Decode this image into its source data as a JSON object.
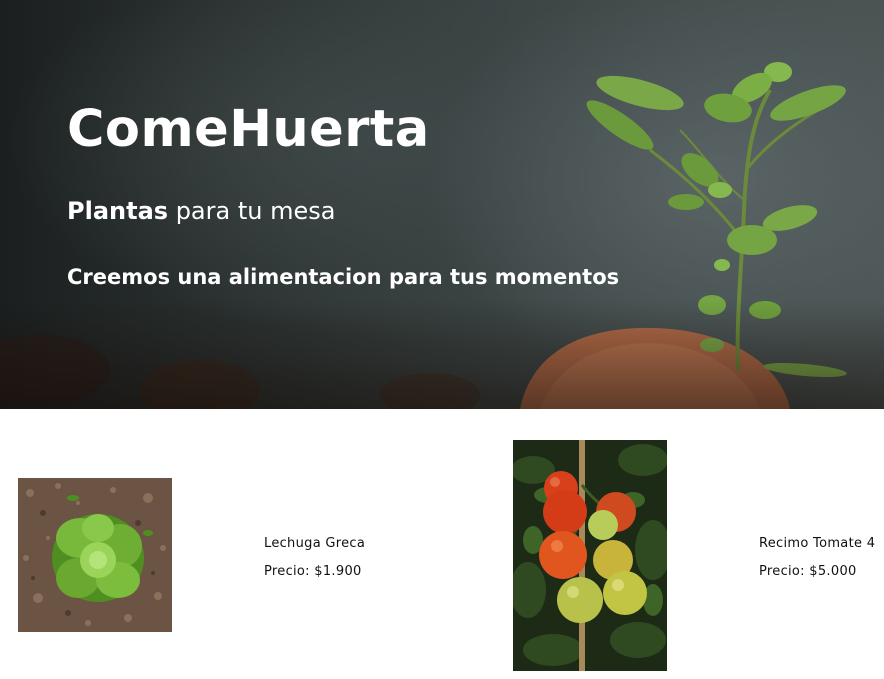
{
  "hero": {
    "title": "ComeHuerta",
    "subtitle_strong": "Plantas",
    "subtitle_rest": " para tu mesa",
    "tagline": "Creemos una alimentacion para tus momentos"
  },
  "products": [
    {
      "name": "Lechuga Greca",
      "price": "Precio: $1.900",
      "image": "lettuce-photo"
    },
    {
      "name": "Recimo Tomate 4",
      "price": "Precio: $5.000",
      "image": "tomato-vine-photo"
    }
  ],
  "colors": {
    "hero_background": "#2f3837",
    "hero_text": "#ffffff",
    "body_background": "#ffffff",
    "product_text": "#111111",
    "leaf_green": "#6fae3a",
    "tomato_red": "#d8401c"
  }
}
